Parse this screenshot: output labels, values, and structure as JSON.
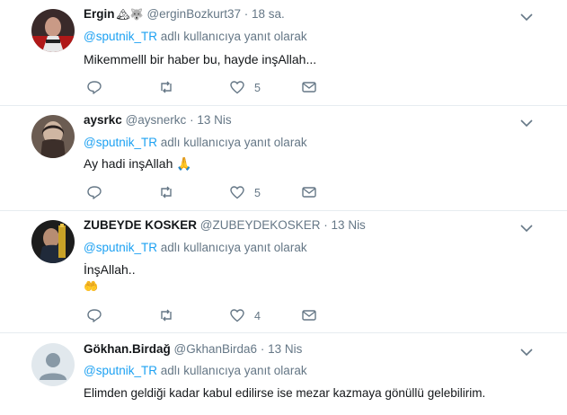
{
  "reply_prefix": "@sputnik_TR",
  "reply_suffix": " adlı kullanıcıya yanıt olarak",
  "tweets": [
    {
      "name": "Ergin",
      "name_emoji": "🏔🐺",
      "handle": "@erginBozkurt37",
      "time": "18 sa.",
      "text": "Mikemmelll bir haber bu, hayde inşAllah...",
      "likes": "5"
    },
    {
      "name": "aysrkc",
      "handle": "@aysnerkc",
      "time": "13 Nis",
      "text": "Ay hadi inşAllah",
      "text_emoji": "🙏",
      "likes": "5"
    },
    {
      "name": "ZUBEYDE KOSKER",
      "handle": "@ZUBEYDEKOSKER",
      "time": "13 Nis",
      "text": "İnşAllah..",
      "text_line2_emoji": "🤲",
      "likes": "4"
    },
    {
      "name": "Gökhan.Birdağ",
      "handle": "@GkhanBirda6",
      "time": "13 Nis",
      "text": "Elimden geldiği kadar kabul edilirse ise mezar kazmaya gönüllü gelebilirim."
    }
  ],
  "icons": [
    "reply-icon",
    "retweet-icon",
    "like-icon",
    "message-icon",
    "chevron-down-icon"
  ],
  "colors": {
    "link": "#1da1f2",
    "secondary": "#657786",
    "divider": "#e6ecf0",
    "text": "#14171a"
  }
}
